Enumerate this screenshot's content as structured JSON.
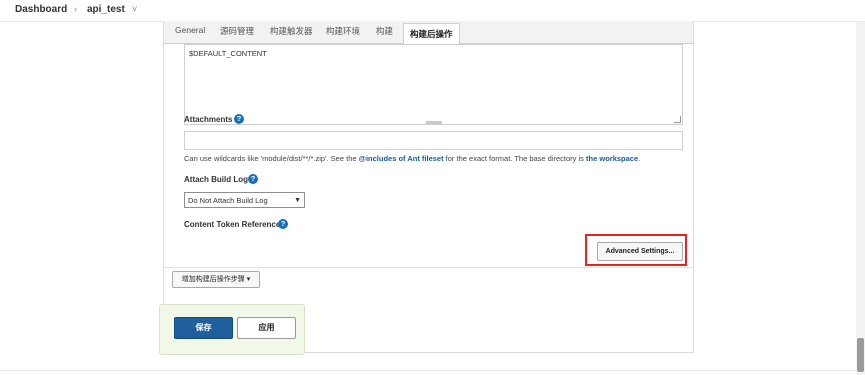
{
  "breadcrumb": {
    "items": [
      "Dashboard",
      "api_test"
    ],
    "separator": "›",
    "dropdown_glyph": "˅"
  },
  "tabs": {
    "items": [
      "General",
      "源码管理",
      "构建触发器",
      "构建环境",
      "构建",
      "构建后操作"
    ],
    "active": "构建后操作"
  },
  "content_textarea": {
    "value": "$DEFAULT_CONTENT"
  },
  "attachments": {
    "label": "Attachments",
    "value": "",
    "hint_prefix": "Can use wildcards like 'module/dist/**/*.zip'. See the ",
    "hint_link1": "@includes of Ant fileset",
    "hint_middle": " for the exact format. The base directory is ",
    "hint_link2": "the workspace",
    "hint_suffix": "."
  },
  "attach_build_log": {
    "label": "Attach Build Log",
    "selected": "Do Not Attach Build Log"
  },
  "content_token_reference": {
    "label": "Content Token Reference"
  },
  "advanced_settings": {
    "label": "Advanced Settings..."
  },
  "add_post_build_step": {
    "label": "增加构建后操作步骤 ▾"
  },
  "actions": {
    "save": "保存",
    "apply": "应用"
  },
  "help_glyph": "?",
  "colors": {
    "accent": "#1b6fb8",
    "highlight_border": "#e8231e",
    "primary_button": "#1f5f9e",
    "savebar_bg": "#f1f8e8"
  }
}
